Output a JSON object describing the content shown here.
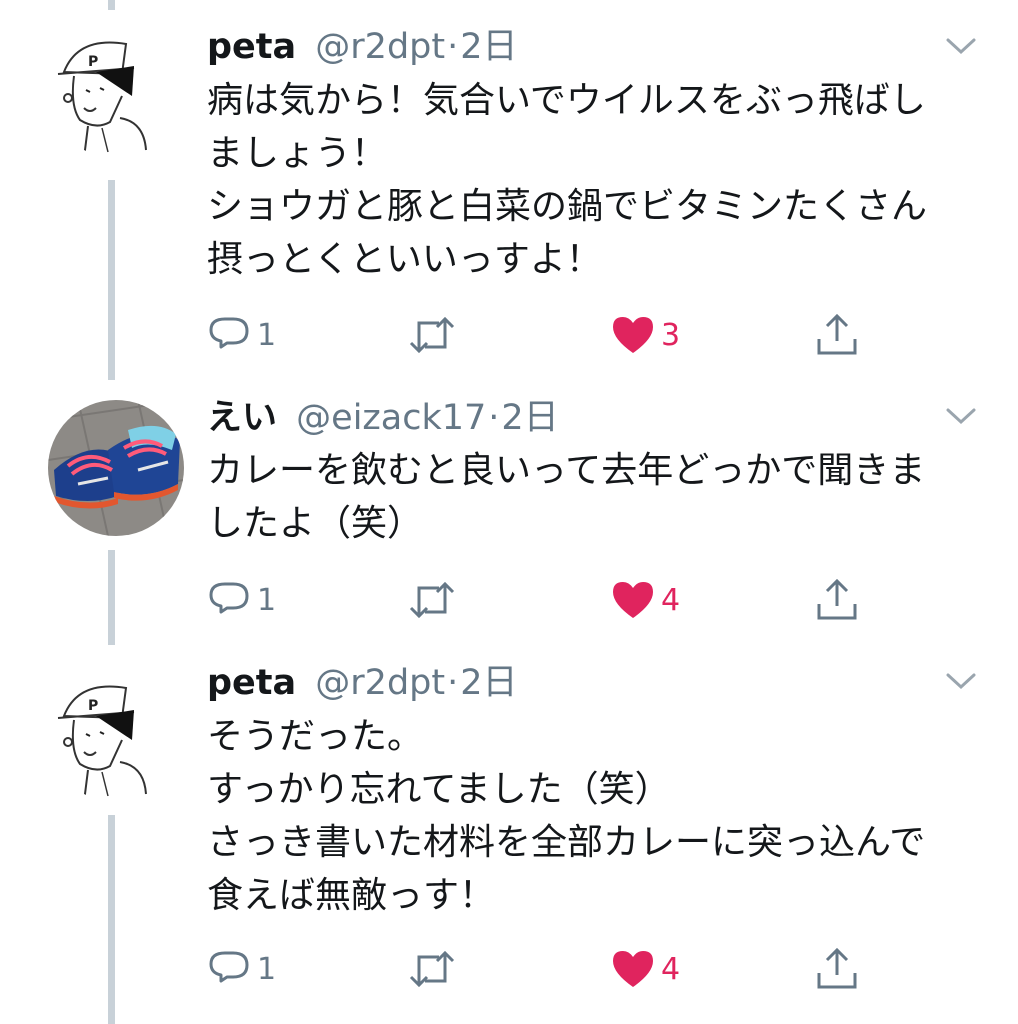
{
  "tweets": [
    {
      "name": "peta",
      "handle": "@r2dpt",
      "separator": "·",
      "time": "2日",
      "avatar": "cartoon-boy-avatar",
      "lines": [
        "病は気から！気合いでウイルスをぶっ飛ばし",
        "ましょう！",
        "ショウガと豚と白菜の鍋でビタミンたくさん",
        "摂っとくといいっすよ！"
      ],
      "replies": "1",
      "likes": "3"
    },
    {
      "name": "えい",
      "handle": "@eizack17",
      "separator": "·",
      "time": "2日",
      "avatar": "sneakers-photo-avatar",
      "lines": [
        "カレーを飲むと良いって去年どっかで聞きま",
        "したよ（笑）"
      ],
      "replies": "1",
      "likes": "4"
    },
    {
      "name": "peta",
      "handle": "@r2dpt",
      "separator": "·",
      "time": "2日",
      "avatar": "cartoon-boy-avatar",
      "lines": [
        "そうだった。",
        "すっかり忘れてました（笑）",
        "さっき書いた材料を全部カレーに突っ込んで",
        "食えば無敵っす！"
      ],
      "replies": "1",
      "likes": "4"
    }
  ],
  "colors": {
    "like": "#e0245e",
    "icon": "#657786",
    "thread_line": "#c8d1d8"
  }
}
